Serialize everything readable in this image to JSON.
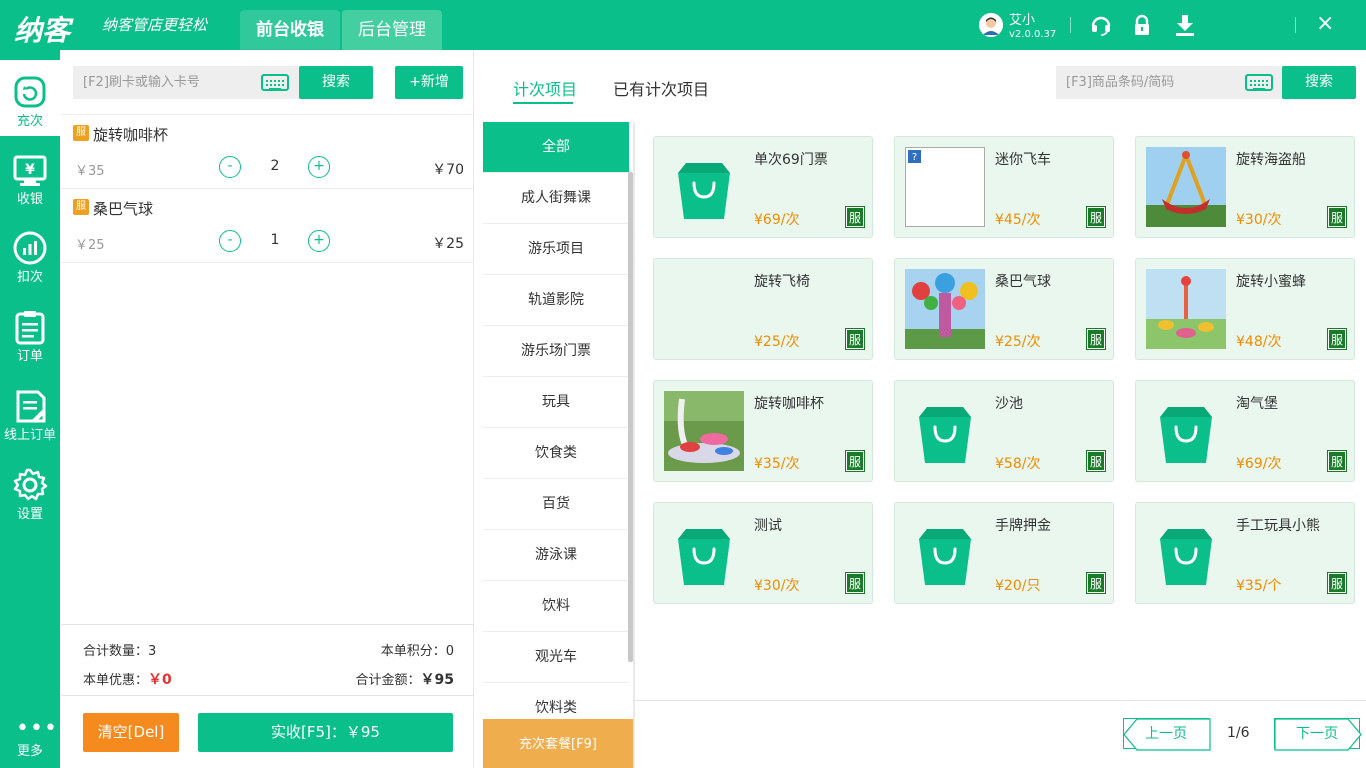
{
  "app": {
    "logo": "纳客",
    "slogan": "纳客管店更轻松",
    "tabs": [
      {
        "label": "前台收银"
      },
      {
        "label": "后台管理"
      }
    ],
    "user": {
      "name": "艾小",
      "version": "v2.0.0.37"
    },
    "icons": [
      "headset-icon",
      "lock-icon",
      "download-icon",
      "close-icon"
    ],
    "close": "×"
  },
  "sidebar": {
    "items": [
      {
        "label": "充次",
        "icon": "recharge-icon"
      },
      {
        "label": "收银",
        "icon": "cashier-icon"
      },
      {
        "label": "扣次",
        "icon": "deduct-icon"
      },
      {
        "label": "订单",
        "icon": "order-icon"
      },
      {
        "label": "线上订单",
        "icon": "online-order-icon"
      },
      {
        "label": "设置",
        "icon": "settings-icon"
      }
    ],
    "more": {
      "dots": "•••",
      "label": "更多"
    }
  },
  "left": {
    "card_placeholder": "[F2]刷卡或输入卡号",
    "search_label": "搜索",
    "add_label": "+新增",
    "cart": [
      {
        "tag": "服",
        "name": "旋转咖啡杯",
        "price": "￥35",
        "qty": "2",
        "total": "￥70"
      },
      {
        "tag": "服",
        "name": "桑巴气球",
        "price": "￥25",
        "qty": "1",
        "total": "￥25"
      }
    ],
    "summary": {
      "count_label": "合计数量：",
      "count": "3",
      "points_label": "本单积分：",
      "points": "0",
      "discount_label": "本单优惠：",
      "discount": "￥0",
      "total_label": "合计金额：",
      "total": "￥95"
    },
    "clear_label": "清空[Del]",
    "pay_label": "实收[F5]：￥95"
  },
  "right": {
    "tabs": [
      {
        "label": "计次项目"
      },
      {
        "label": "已有计次项目"
      }
    ],
    "barcode_placeholder": "[F3]商品条码/简码",
    "search_label": "搜索",
    "categories": [
      "全部",
      "成人街舞课",
      "游乐项目",
      "轨道影院",
      "游乐场门票",
      "玩具",
      "饮食类",
      "百货",
      "游泳课",
      "饮料",
      "观光车",
      "饮料类"
    ],
    "package_label": "充次套餐[F9]",
    "products": [
      {
        "name": "单次69门票",
        "price": "¥69/次",
        "badge": "服",
        "img": "bag"
      },
      {
        "name": "迷你飞车",
        "price": "¥45/次",
        "badge": "服",
        "img": "broken"
      },
      {
        "name": "旋转海盗船",
        "price": "¥30/次",
        "badge": "服",
        "img": "pirate"
      },
      {
        "name": "旋转飞椅",
        "price": "¥25/次",
        "badge": "服",
        "img": "none"
      },
      {
        "name": "桑巴气球",
        "price": "¥25/次",
        "badge": "服",
        "img": "balloon"
      },
      {
        "name": "旋转小蜜蜂",
        "price": "¥48/次",
        "badge": "服",
        "img": "bee"
      },
      {
        "name": "旋转咖啡杯",
        "price": "¥35/次",
        "badge": "服",
        "img": "cup"
      },
      {
        "name": "沙池",
        "price": "¥58/次",
        "badge": "服",
        "img": "bag"
      },
      {
        "name": "淘气堡",
        "price": "¥69/次",
        "badge": "服",
        "img": "bag"
      },
      {
        "name": "测试",
        "price": "¥30/次",
        "badge": "服",
        "img": "bag"
      },
      {
        "name": "手牌押金",
        "price": "¥20/只",
        "badge": "服",
        "img": "bag"
      },
      {
        "name": "手工玩具小熊",
        "price": "¥35/个",
        "badge": "服",
        "img": "bag"
      }
    ],
    "pager": {
      "prev": "上一页",
      "page": "1/6",
      "next": "下一页"
    }
  },
  "colors": {
    "brand": "#0bbf8a",
    "orange": "#f58a1f",
    "price": "#f08c00",
    "discount": "#e83030",
    "badge": "#1a7a2a"
  }
}
